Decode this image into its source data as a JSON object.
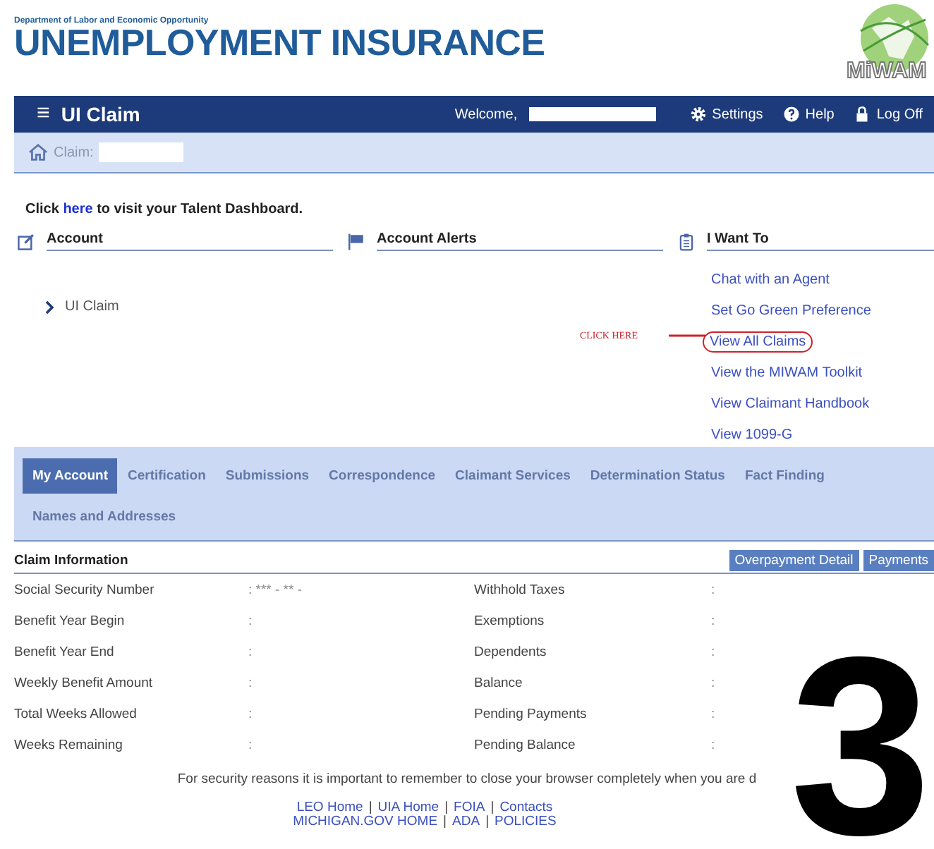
{
  "header": {
    "department": "Department of Labor and Economic Opportunity",
    "title": "UNEMPLOYMENT INSURANCE",
    "logo_text": "MiWAM"
  },
  "navbar": {
    "menu_icon": "≡",
    "title": "UI Claim",
    "welcome": "Welcome,",
    "links": [
      {
        "kind": "settings",
        "label": "Settings"
      },
      {
        "kind": "help",
        "label": "Help"
      },
      {
        "kind": "lock",
        "label": "Log Off"
      }
    ]
  },
  "breadcrumb": {
    "label": "Claim:"
  },
  "talent": {
    "before": "Click ",
    "link": "here",
    "after": " to visit your Talent Dashboard."
  },
  "panels": [
    {
      "kind": "account",
      "title": "Account",
      "items": [
        {
          "label": "UI Claim"
        }
      ]
    },
    {
      "kind": "alerts",
      "title": "Account Alerts"
    },
    {
      "kind": "iwant",
      "title": "I Want To"
    }
  ],
  "i_want_to": [
    {
      "label": "Chat with an Agent",
      "circled": false
    },
    {
      "label": "Set Go Green Preference",
      "circled": false
    },
    {
      "label": "View All Claims",
      "circled": true
    },
    {
      "label": "View the MIWAM Toolkit",
      "circled": false
    },
    {
      "label": "View Claimant Handbook",
      "circled": false
    },
    {
      "label": "View 1099-G",
      "circled": false
    }
  ],
  "annotation": {
    "label": "CLICK HERE",
    "step": "3"
  },
  "tabs": [
    {
      "label": "My Account",
      "selected": true
    },
    {
      "label": "Certification",
      "selected": false
    },
    {
      "label": "Submissions",
      "selected": false
    },
    {
      "label": "Correspondence",
      "selected": false
    },
    {
      "label": "Claimant Services",
      "selected": false
    },
    {
      "label": "Determination Status",
      "selected": false
    },
    {
      "label": "Fact Finding",
      "selected": false
    },
    {
      "label": "Names and Addresses",
      "selected": false
    }
  ],
  "claim_info": {
    "title": "Claim Information",
    "buttons": [
      "Overpayment Detail",
      "Payments"
    ],
    "rows": [
      {
        "label": "Social Security Number",
        "value": ": *** - ** -",
        "label2": "Withhold Taxes",
        "value2": ":"
      },
      {
        "label": "Benefit Year Begin",
        "value": ":",
        "label2": "Exemptions",
        "value2": ":"
      },
      {
        "label": "Benefit Year End",
        "value": ":",
        "label2": "Dependents",
        "value2": ":"
      },
      {
        "label": "Weekly Benefit Amount",
        "value": ":",
        "label2": "Balance",
        "value2": ":"
      },
      {
        "label": "Total Weeks Allowed",
        "value": ":",
        "label2": "Pending Payments",
        "value2": ":"
      },
      {
        "label": "Weeks Remaining",
        "value": ":",
        "label2": "Pending Balance",
        "value2": ":"
      }
    ]
  },
  "footer": {
    "notice": "For security reasons it is important to remember to close your browser completely when you are d",
    "separator": "|",
    "links": [
      [
        "LEO Home",
        "UIA Home",
        "FOIA",
        "Contacts"
      ],
      [
        "MICHIGAN.GOV HOME",
        "ADA",
        "POLICIES"
      ]
    ]
  }
}
